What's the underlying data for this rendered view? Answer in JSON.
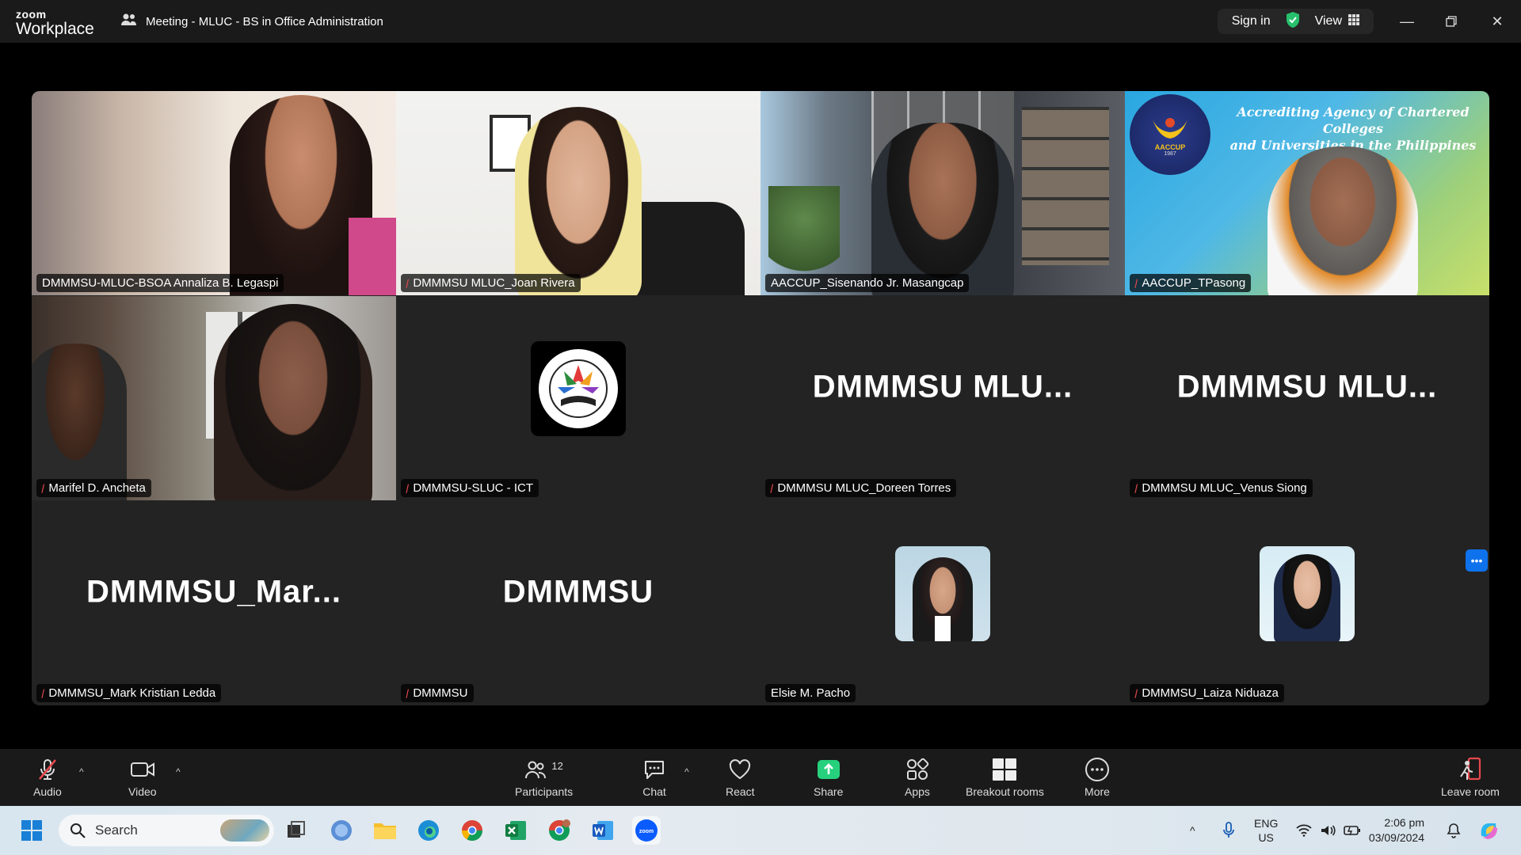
{
  "titlebar": {
    "brand_top": "zoom",
    "brand_bottom": "Workplace",
    "meeting_title": "Meeting - MLUC - BS in Office Administration",
    "sign_in": "Sign in",
    "view": "View"
  },
  "tiles": [
    {
      "name": "DMMMSU-MLUC-BSOA Annaliza B. Legaspi",
      "muted": false,
      "type": "video"
    },
    {
      "name": "DMMMSU MLUC_Joan Rivera",
      "muted": true,
      "type": "video"
    },
    {
      "name": "AACCUP_Sisenando Jr. Masangcap",
      "muted": false,
      "type": "video",
      "active": true
    },
    {
      "name": "AACCUP_TPasong",
      "muted": true,
      "type": "video",
      "banner_line1": "Accrediting Agency of Chartered Colleges",
      "banner_line2": "and Universities in the Philippines",
      "seal_text": "AACCUP",
      "seal_year": "1987"
    },
    {
      "name": "Marifel D. Ancheta",
      "muted": true,
      "type": "video"
    },
    {
      "name": "DMMMSU-SLUC - ICT",
      "muted": true,
      "type": "logo"
    },
    {
      "name": "DMMMSU MLUC_Doreen Torres",
      "muted": true,
      "type": "text",
      "display": "DMMMSU  MLU..."
    },
    {
      "name": "DMMMSU MLUC_Venus Siong",
      "muted": true,
      "type": "text",
      "display": "DMMMSU  MLU..."
    },
    {
      "name": "DMMMSU_Mark Kristian Ledda",
      "muted": true,
      "type": "text",
      "display": "DMMMSU_Mar..."
    },
    {
      "name": "DMMMSU",
      "muted": true,
      "type": "text",
      "display": "DMMMSU"
    },
    {
      "name": "Elsie M. Pacho",
      "muted": false,
      "type": "photo"
    },
    {
      "name": "DMMMSU_Laiza Niduaza",
      "muted": true,
      "type": "photo"
    }
  ],
  "toolbar": {
    "audio": "Audio",
    "video": "Video",
    "participants": "Participants",
    "participants_count": "12",
    "chat": "Chat",
    "react": "React",
    "share": "Share",
    "apps": "Apps",
    "breakout": "Breakout rooms",
    "more": "More",
    "leave": "Leave room"
  },
  "taskbar": {
    "search_placeholder": "Search",
    "lang_top": "ENG",
    "lang_bottom": "US",
    "time": "2:06 pm",
    "date": "03/09/2024"
  },
  "colors": {
    "active_speaker": "#26d07c",
    "muted": "#e5484d",
    "share": "#26d07c",
    "leave": "#e5484d"
  }
}
